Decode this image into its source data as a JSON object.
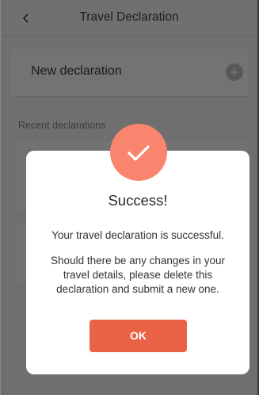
{
  "appbar": {
    "back_icon": "chevron-left-icon",
    "title": "Travel Declaration"
  },
  "main": {
    "new_declaration_label": "New declaration",
    "add_icon": "plus-circle-icon",
    "recent_label": "Recent declarations"
  },
  "modal": {
    "icon": "check-icon",
    "icon_color": "#f9856e",
    "title": "Success!",
    "message": "Your travel declaration is successful.",
    "detail": "Should there be any changes in your travel details, please delete this declaration and submit a new one.",
    "ok_label": "OK",
    "ok_color": "#eb6346"
  }
}
